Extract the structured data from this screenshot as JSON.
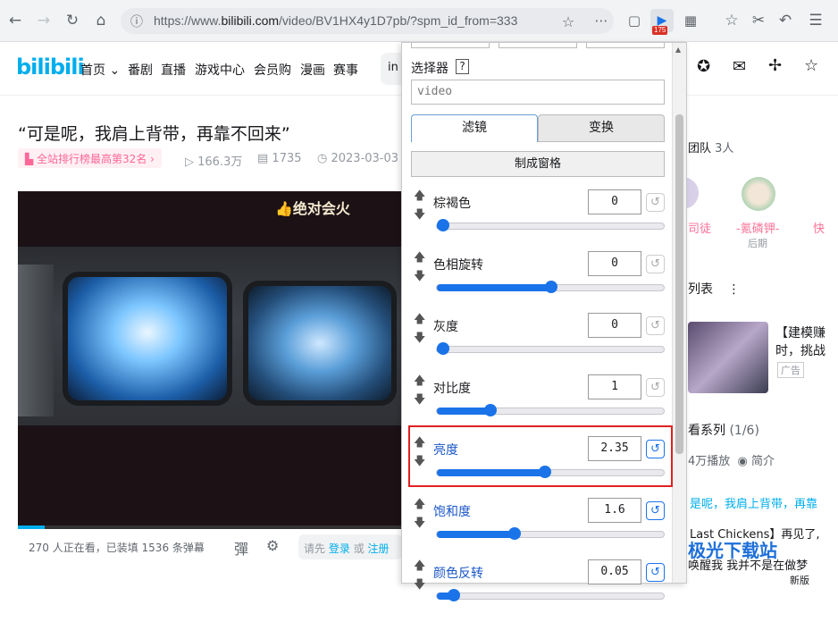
{
  "browser": {
    "url_prefix": "https://www.",
    "url_domain": "bilibili.com",
    "url_path": "/video/BV1HX4y1D7pb/?spm_id_from=333",
    "extension_badge": "175",
    "icons": [
      "back-icon",
      "forward-icon",
      "reload-icon",
      "home-icon",
      "info-icon",
      "grid-icon",
      "star-icon",
      "puzzle-icon",
      "bookmark-icon",
      "cut-icon",
      "undo-icon",
      "menu-icon"
    ]
  },
  "bili": {
    "logo": "bilibili",
    "nav": [
      "首页",
      "番剧",
      "直播",
      "游戏中心",
      "会员购",
      "漫画",
      "赛事"
    ],
    "search_partial": "in"
  },
  "video": {
    "title": "“可是呢，我肩上背带，再靠不回来”",
    "rank_badge": "全站排行榜最高第32名",
    "plays": "166.3万",
    "danmaku": "1735",
    "date": "2023-03-03",
    "watermark": "绝对会火",
    "viewers": "270 人正在看，已装填 1536 条弹幕",
    "danmu_hint_prefix": "请先",
    "danmu_login": "登录",
    "danmu_or": "或",
    "danmu_register": "注册",
    "progress": 0.07
  },
  "right": {
    "team": "团队",
    "team_count": "3人",
    "member1": "司徒",
    "member2": "-氪磷钾-",
    "member2_role": "后期",
    "member3": "快",
    "list_title": "列表",
    "ad_title_1": "【建模赚",
    "ad_title_2": "时，挑战",
    "ad_tag": "广告",
    "series": "看系列",
    "series_count": "(1/6)",
    "series_plays": "4万播放",
    "series_intro": "简介",
    "item1": "是呢，我肩上背带，再靠",
    "item2_a": "Last Chickens",
    "item2_b": "】再见了,",
    "item3": "唤醒我 我并不是在做梦",
    "item4": "新版"
  },
  "panel": {
    "selector_label": "选择器",
    "help": "?",
    "selector_value": "video",
    "tabs": [
      "滤镜",
      "变换"
    ],
    "mosaic_button": "制成窗格",
    "filters": [
      {
        "label": "棕褐色",
        "value": "0",
        "fraction": 0.0,
        "active": false
      },
      {
        "label": "色相旋转",
        "value": "0",
        "fraction": 0.5,
        "active": false
      },
      {
        "label": "灰度",
        "value": "0",
        "fraction": 0.0,
        "active": false
      },
      {
        "label": "对比度",
        "value": "1",
        "fraction": 0.22,
        "active": false
      },
      {
        "label": "亮度",
        "value": "2.35",
        "fraction": 0.47,
        "active": true
      },
      {
        "label": "饱和度",
        "value": "1.6",
        "fraction": 0.33,
        "active": true
      },
      {
        "label": "颜色反转",
        "value": "0.05",
        "fraction": 0.05,
        "active": true
      }
    ],
    "colors": {
      "accent": "#1a73e8",
      "highlight": "#e02020"
    }
  },
  "site_watermark": "极光下载站"
}
